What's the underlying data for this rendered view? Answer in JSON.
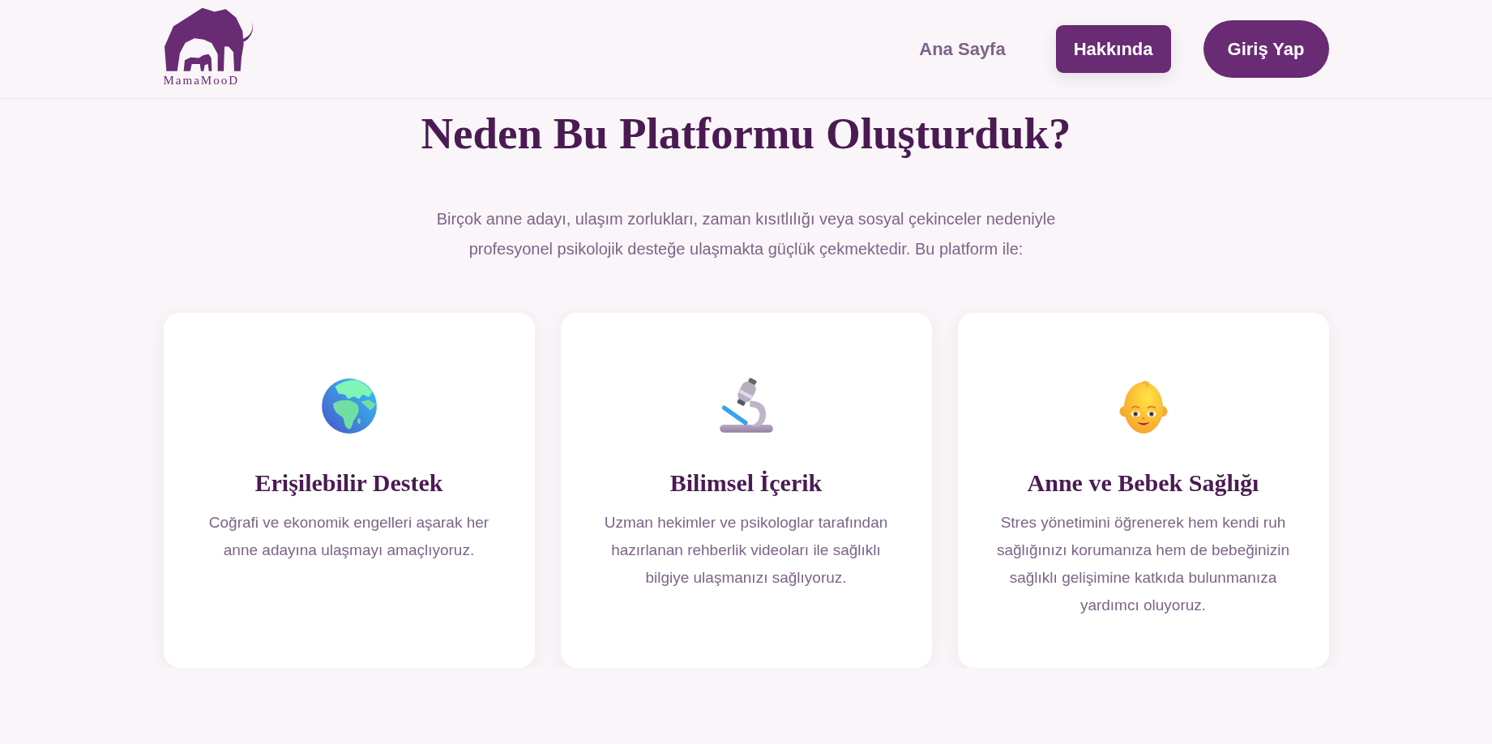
{
  "header": {
    "logo": {
      "text": "MamaMooD"
    },
    "nav": [
      {
        "label": "Ana Sayfa",
        "selected": false
      },
      {
        "label": "Hakkında",
        "selected": true
      }
    ],
    "login_button": {
      "label": "Giriş Yap"
    }
  },
  "section": {
    "title": "Neden Bu Platformu Oluşturduk?",
    "intro": "Birçok anne adayı, ulaşım zorlukları, zaman kısıtlılığı veya sosyal çekinceler nedeniyle profesyonel psikolojik desteğe ulaşmakta güçlük çekmektedir. Bu platform ile:",
    "cards": [
      {
        "title": "Erişilebilir Destek",
        "text": "Coğrafi ve ekonomik engelleri aşarak her anne adayına ulaşmayı amaçlıyoruz."
      },
      {
        "title": "Bilimsel İçerik",
        "text": "Uzman hekimler ve psikologlar tarafından hazırlanan rehberlik videoları ile sağlıklı bilgiye ulaşmanızı sağlıyoruz."
      },
      {
        "title": "Anne ve Bebek Sağlığı",
        "text": "Stres yönetimini öğrenerek hem kendi ruh sağlığınızı korumanıza hem de bebeğinizin sağlıklı gelişimine katkıda bulunmanıza yardımcı oluyoruz."
      }
    ]
  }
}
